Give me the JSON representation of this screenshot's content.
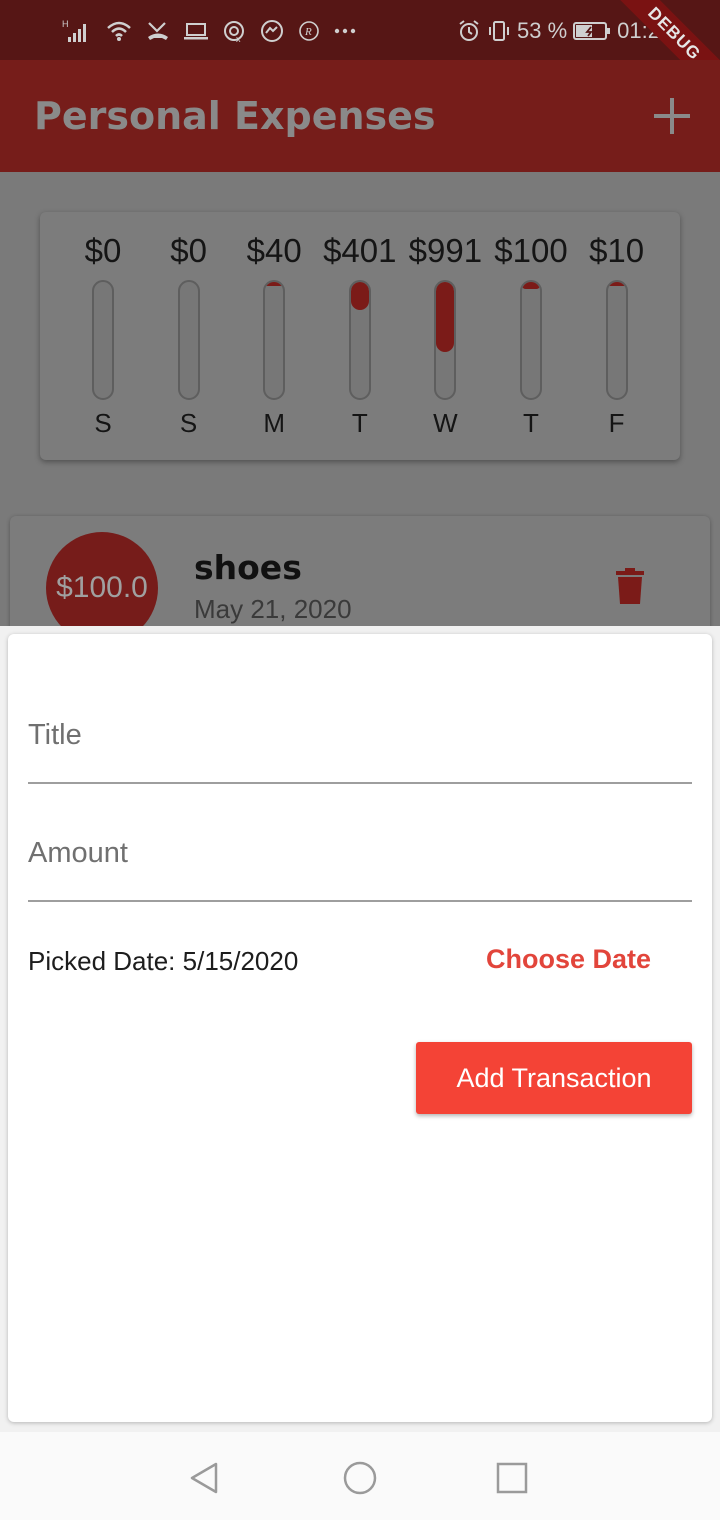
{
  "status_bar": {
    "battery_text": "53 %",
    "time_text": "01:2",
    "left_icons": [
      "signal-icon",
      "wifi-icon",
      "missed-call-icon",
      "laptop-icon",
      "hotspot-icon",
      "messenger-icon",
      "r-icon",
      "more-icon"
    ],
    "right_icons": [
      "alarm-icon",
      "vibrate-icon",
      "battery-icon"
    ]
  },
  "debug_banner": "DEBUG",
  "app_bar": {
    "title": "Personal Expenses",
    "add_icon": "plus-icon"
  },
  "chart_data": {
    "type": "bar",
    "categories": [
      "S",
      "S",
      "M",
      "T",
      "W",
      "T",
      "F"
    ],
    "values": [
      0,
      0,
      40,
      401,
      991,
      100,
      10
    ],
    "value_labels": [
      "$0",
      "$0",
      "$40",
      "$401",
      "$991",
      "$100",
      "$10"
    ],
    "fill_fraction": [
      0.0,
      0.0,
      0.024,
      0.24,
      0.6,
      0.06,
      0.006
    ],
    "title": "",
    "xlabel": "",
    "ylabel": "",
    "grid": false,
    "legend": "none"
  },
  "transactions": [
    {
      "amount": "$100.0",
      "title": "shoes",
      "date": "May 21, 2020",
      "delete_icon": "trash-icon"
    }
  ],
  "form": {
    "title_placeholder": "Title",
    "amount_placeholder": "Amount",
    "picked_date": "Picked Date: 5/15/2020",
    "choose_date_label": "Choose Date",
    "add_button_label": "Add Transaction"
  },
  "colors": {
    "primary": "#f44336",
    "accent_text": "#e2453b"
  },
  "nav_bar": [
    "back-icon",
    "home-icon",
    "recents-icon"
  ]
}
